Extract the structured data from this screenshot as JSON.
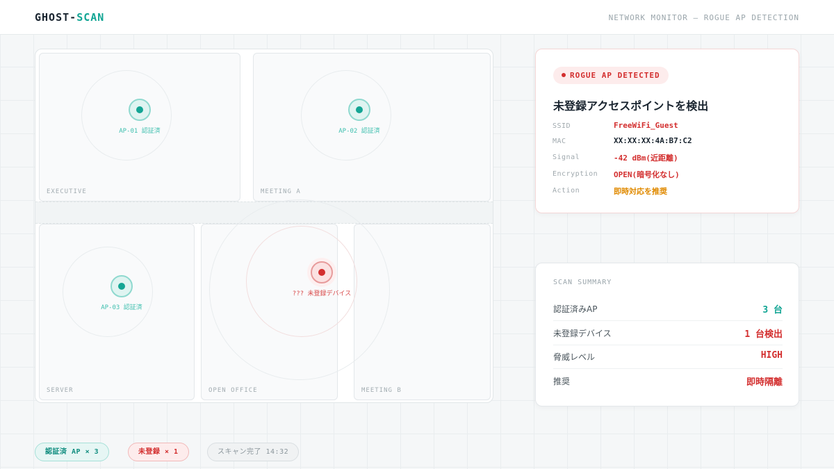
{
  "header": {
    "brand_prefix": "GHOST-",
    "brand_accent": "SCAN",
    "subtitle": "NETWORK MONITOR — ROGUE AP DETECTION"
  },
  "floorplan": {
    "rooms": [
      "EXECUTIVE",
      "MEETING A",
      "SERVER",
      "OPEN OFFICE",
      "MEETING B"
    ],
    "access_points": [
      {
        "label": "AP-01 認証済",
        "status": "authorized"
      },
      {
        "label": "AP-02 認証済",
        "status": "authorized"
      },
      {
        "label": "AP-03 認証済",
        "status": "authorized"
      },
      {
        "label": "??? 未登録デバイス",
        "status": "rogue"
      }
    ]
  },
  "alert": {
    "badge": "ROGUE AP DETECTED",
    "title": "未登録アクセスポイントを検出",
    "fields": [
      {
        "key": "SSID",
        "value": "FreeWiFi_Guest",
        "color": "#d32f2f"
      },
      {
        "key": "MAC",
        "value": "XX:XX:XX:4A:B7:C2",
        "color": "#1a2530"
      },
      {
        "key": "Signal",
        "value": "-42 dBm(近距離)",
        "color": "#d32f2f"
      },
      {
        "key": "Encryption",
        "value": "OPEN(暗号化なし)",
        "color": "#d32f2f"
      },
      {
        "key": "Action",
        "value": "即時対応を推奨",
        "color": "#e08a00"
      }
    ]
  },
  "summary": {
    "heading": "SCAN SUMMARY",
    "rows": [
      {
        "key": "認証済みAP",
        "value": "3 台",
        "color": "#12a594"
      },
      {
        "key": "未登録デバイス",
        "value": "1 台検出",
        "color": "#d32f2f"
      },
      {
        "key": "脅威レベル",
        "value": "HIGH",
        "color": "#d32f2f"
      },
      {
        "key": "推奨",
        "value": "即時隔離",
        "color": "#d32f2f"
      }
    ]
  },
  "footer": {
    "chips": [
      {
        "label": "認証済 AP × 3",
        "tone": "green"
      },
      {
        "label": "未登録 × 1",
        "tone": "red"
      },
      {
        "label": "スキャン完了 14:32",
        "tone": "gray"
      }
    ]
  },
  "colors": {
    "accent": "#12a594",
    "danger": "#d32f2f",
    "warning": "#e08a00"
  }
}
